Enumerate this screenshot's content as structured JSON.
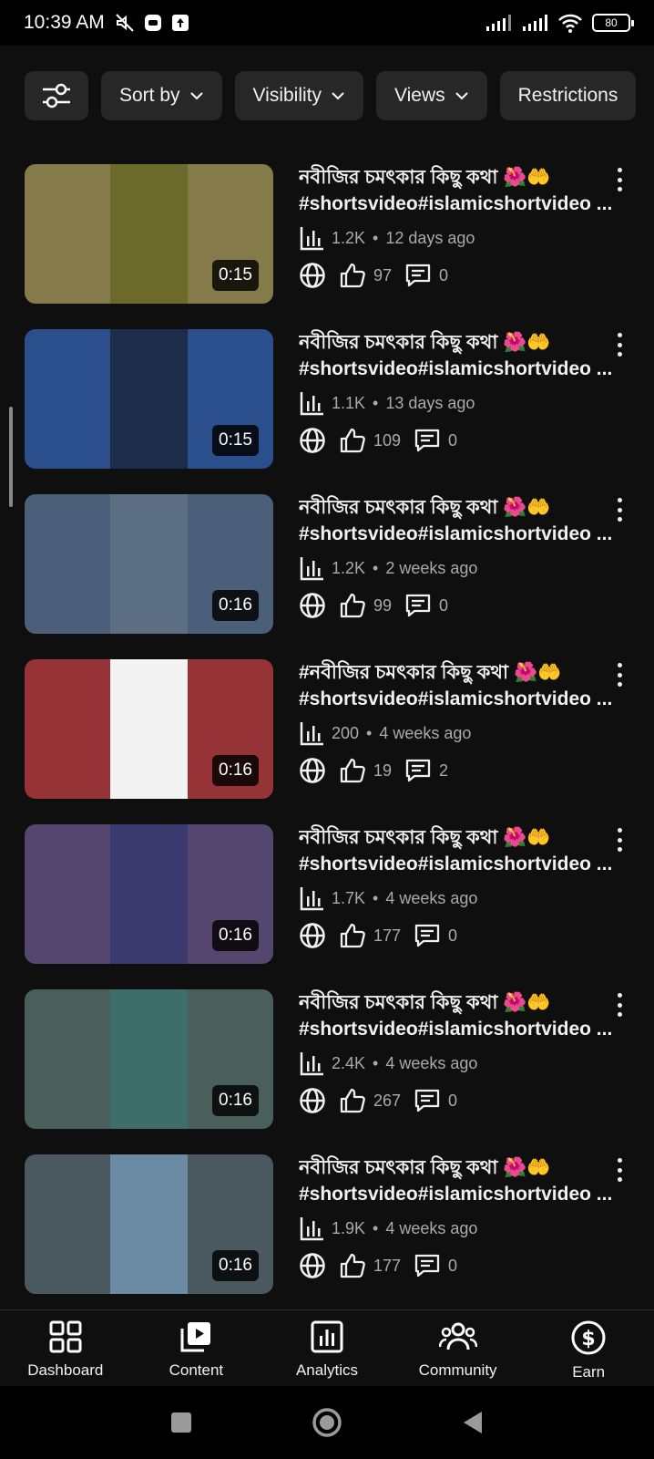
{
  "status_bar": {
    "time": "10:39 AM",
    "battery": "80"
  },
  "chips": {
    "sort_by": "Sort by",
    "visibility": "Visibility",
    "views": "Views",
    "restrictions": "Restrictions"
  },
  "videos": [
    {
      "title1": "নবীজির চমৎকার কিছু কথা 🌺🤲",
      "title2": "#shortsvideo#islamicshortvideo ...",
      "views": "1.2K",
      "age": "12 days ago",
      "likes": "97",
      "comments": "0",
      "duration": "0:15",
      "bg": "#857a4a",
      "inner": "#6b6a2a"
    },
    {
      "title1": "নবীজির চমৎকার কিছু কথা 🌺🤲",
      "title2": "#shortsvideo#islamicshortvideo ...",
      "views": "1.1K",
      "age": "13 days ago",
      "likes": "109",
      "comments": "0",
      "duration": "0:15",
      "bg": "#2b4e8c",
      "inner": "#1d2c4a"
    },
    {
      "title1": "নবীজির চমৎকার কিছু কথা 🌺🤲",
      "title2": "#shortsvideo#islamicshortvideo ...",
      "views": "1.2K",
      "age": "2 weeks ago",
      "likes": "99",
      "comments": "0",
      "duration": "0:16",
      "bg": "#4b5f7a",
      "inner": "#5d6f83"
    },
    {
      "title1": "#নবীজির চমৎকার কিছু কথা 🌺🤲",
      "title2": "#shortsvideo#islamicshortvideo ...",
      "views": "200",
      "age": "4 weeks ago",
      "likes": "19",
      "comments": "2",
      "duration": "0:16",
      "bg": "#953336",
      "inner": "#f3f3f3"
    },
    {
      "title1": "নবীজির চমৎকার কিছু কথা 🌺🤲",
      "title2": "#shortsvideo#islamicshortvideo ...",
      "views": "1.7K",
      "age": "4 weeks ago",
      "likes": "177",
      "comments": "0",
      "duration": "0:16",
      "bg": "#54466e",
      "inner": "#3a3a6e"
    },
    {
      "title1": "নবীজির চমৎকার কিছু কথা 🌺🤲",
      "title2": "#shortsvideo#islamicshortvideo ...",
      "views": "2.4K",
      "age": "4 weeks ago",
      "likes": "267",
      "comments": "0",
      "duration": "0:16",
      "bg": "#4a5f5a",
      "inner": "#3d6e6a"
    },
    {
      "title1": "নবীজির চমৎকার কিছু কথা 🌺🤲",
      "title2": "#shortsvideo#islamicshortvideo ...",
      "views": "1.9K",
      "age": "4 weeks ago",
      "likes": "177",
      "comments": "0",
      "duration": "0:16",
      "bg": "#4a5860",
      "inner": "#6b8aa3"
    }
  ],
  "nav": {
    "dashboard": "Dashboard",
    "content": "Content",
    "analytics": "Analytics",
    "community": "Community",
    "earn": "Earn"
  },
  "colors": {
    "background": "#0f0f0f",
    "chip": "#272727",
    "secondary_text": "#aaaaaa"
  }
}
